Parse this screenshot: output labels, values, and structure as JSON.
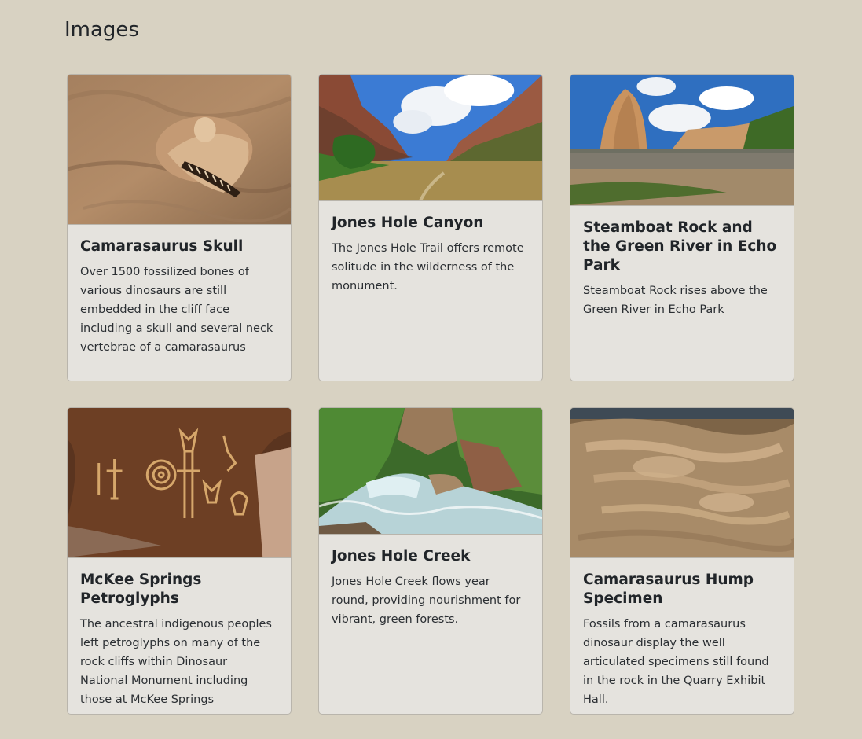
{
  "page": {
    "title": "Images"
  },
  "cards": [
    {
      "title": "Camarasaurus Skull",
      "text": "Over 1500 fossilized bones of various dinosaurs are still embedded in the cliff face including a skull and several neck vertebrae of a camarasaurus",
      "image": "camarasaurus-skull-fossil-photo"
    },
    {
      "title": "Jones Hole Canyon",
      "text": "The Jones Hole Trail offers remote solitude in the wilderness of the monument.",
      "image": "jones-hole-canyon-photo"
    },
    {
      "title": "Steamboat Rock and the Green River in Echo Park",
      "text": "Steamboat Rock rises above the Green River in Echo Park",
      "image": "steamboat-rock-photo"
    },
    {
      "title": "McKee Springs Petroglyphs",
      "text": "The ancestral indigenous peoples left petroglyphs on many of the rock cliffs within Dinosaur National Monument including those at McKee Springs",
      "image": "mckee-springs-petroglyphs-photo"
    },
    {
      "title": "Jones Hole Creek",
      "text": "Jones Hole Creek flows year round, providing nourishment for vibrant, green forests.",
      "image": "jones-hole-creek-photo"
    },
    {
      "title": "Camarasaurus Hump Specimen",
      "text": "Fossils from a camarasaurus dinosaur display the well articulated specimens still found in the rock in the Quarry Exhibit Hall.",
      "image": "camarasaurus-hump-fossil-photo"
    }
  ]
}
